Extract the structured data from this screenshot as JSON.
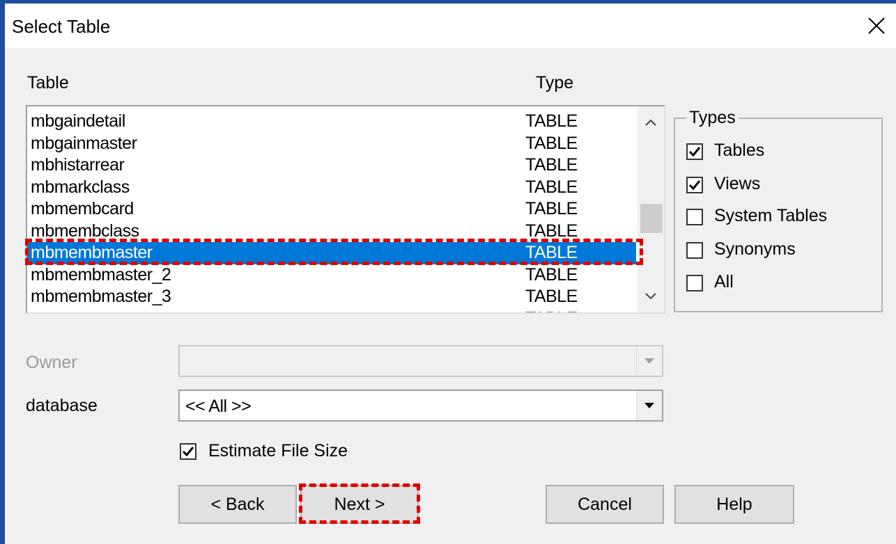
{
  "window": {
    "title": "Select Table",
    "close_glyph": "✕"
  },
  "table_list": {
    "header_table": "Table",
    "header_type": "Type",
    "rows": [
      {
        "name": "mbgaindetail",
        "type": "TABLE"
      },
      {
        "name": "mbgainmaster",
        "type": "TABLE"
      },
      {
        "name": "mbhistarrear",
        "type": "TABLE"
      },
      {
        "name": "mbmarkclass",
        "type": "TABLE"
      },
      {
        "name": "mbmembcard",
        "type": "TABLE"
      },
      {
        "name": "mbmembclass",
        "type": "TABLE"
      },
      {
        "name": "mbmembmaster",
        "type": "TABLE",
        "selected": true
      },
      {
        "name": "mbmembmaster_2",
        "type": "TABLE"
      },
      {
        "name": "mbmembmaster_3",
        "type": "TABLE"
      },
      {
        "name": "",
        "type": "TABLE"
      }
    ]
  },
  "types_group": {
    "legend": "Types",
    "options": [
      {
        "label": "Tables",
        "checked": true
      },
      {
        "label": "Views",
        "checked": true
      },
      {
        "label": "System Tables",
        "checked": false
      },
      {
        "label": "Synonyms",
        "checked": false
      },
      {
        "label": "All",
        "checked": false
      }
    ]
  },
  "owner": {
    "label": "Owner",
    "value": "",
    "enabled": false
  },
  "database": {
    "label": "database",
    "value": "<< All >>"
  },
  "estimate_file_size": {
    "label": "Estimate File Size",
    "checked": true
  },
  "buttons": {
    "back": "< Back",
    "next": "Next >",
    "cancel": "Cancel",
    "help": "Help"
  },
  "colors": {
    "selection": "#0078d7",
    "annotation": "#e00000",
    "dialog_bg": "#f0f0f0"
  },
  "icons": {
    "scroll_up": "chevron-up-icon",
    "scroll_down": "chevron-down-icon",
    "combo_arrow": "caret-down-icon",
    "check": "check-icon"
  }
}
